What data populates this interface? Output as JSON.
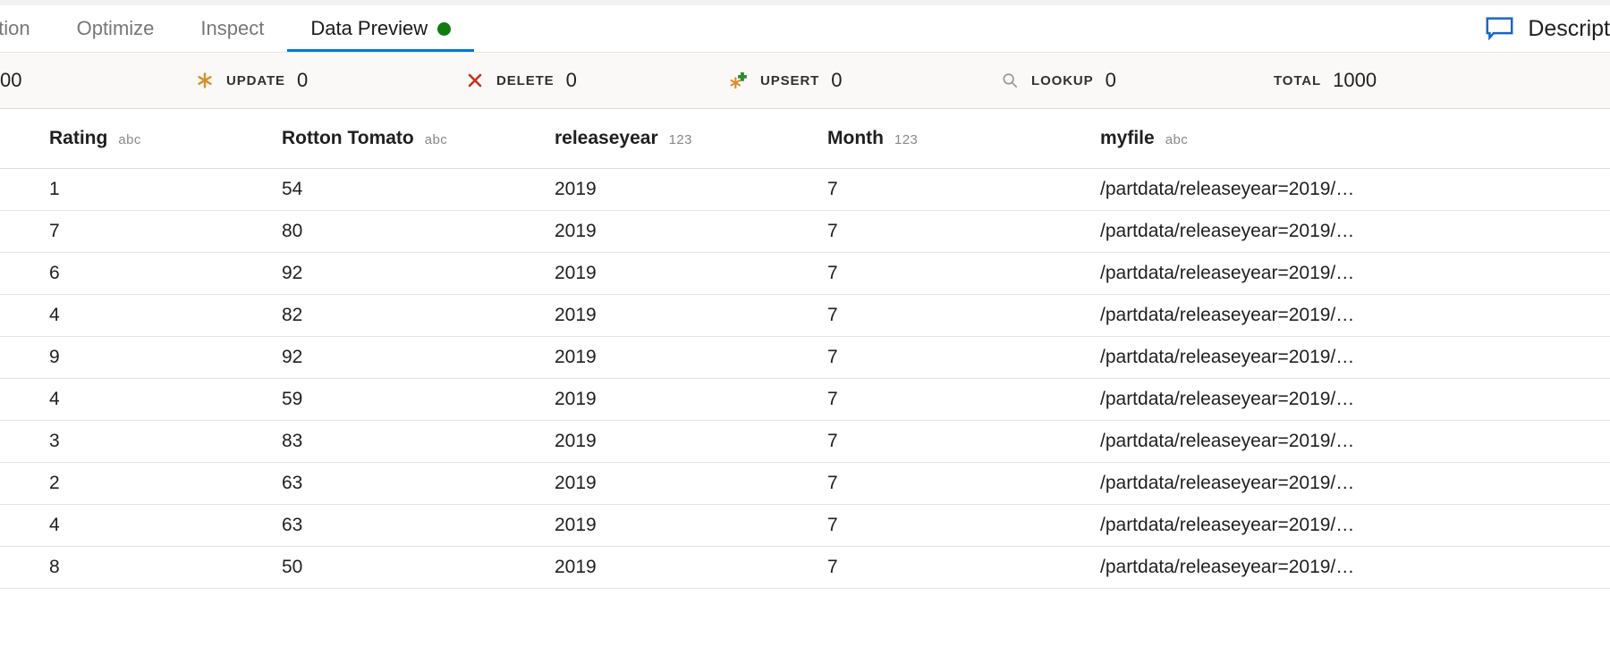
{
  "tabs": [
    {
      "label": "jection",
      "active": false,
      "clipped": true,
      "dot": false
    },
    {
      "label": "Optimize",
      "active": false,
      "clipped": false,
      "dot": false
    },
    {
      "label": "Inspect",
      "active": false,
      "clipped": false,
      "dot": false
    },
    {
      "label": "Data Preview",
      "active": true,
      "clipped": false,
      "dot": true
    }
  ],
  "toolbar": {
    "description_label": "Descript",
    "description_icon": "comment-bubble-icon"
  },
  "stats": {
    "partial_left_value": "00",
    "items": [
      {
        "id": "update",
        "label": "UPDATE",
        "value": "0",
        "icon": "asterisk-icon",
        "color": "#d98f2b"
      },
      {
        "id": "delete",
        "label": "DELETE",
        "value": "0",
        "icon": "cross-icon",
        "color": "#c4321c"
      },
      {
        "id": "upsert",
        "label": "UPSERT",
        "value": "0",
        "icon": "asterisk-plus-icon",
        "color": "#d98f2b"
      },
      {
        "id": "lookup",
        "label": "LOOKUP",
        "value": "0",
        "icon": "search-icon",
        "color": "#8a8886"
      },
      {
        "id": "total",
        "label": "TOTAL",
        "value": "1000",
        "icon": "none",
        "color": "#323130"
      }
    ]
  },
  "table": {
    "columns": [
      {
        "name": "Rating",
        "type": "abc"
      },
      {
        "name": "Rotton Tomato",
        "type": "abc"
      },
      {
        "name": "releaseyear",
        "type": "123"
      },
      {
        "name": "Month",
        "type": "123"
      },
      {
        "name": "myfile",
        "type": "abc"
      }
    ],
    "rows": [
      [
        "1",
        "54",
        "2019",
        "7",
        "/partdata/releaseyear=2019/…"
      ],
      [
        "7",
        "80",
        "2019",
        "7",
        "/partdata/releaseyear=2019/…"
      ],
      [
        "6",
        "92",
        "2019",
        "7",
        "/partdata/releaseyear=2019/…"
      ],
      [
        "4",
        "82",
        "2019",
        "7",
        "/partdata/releaseyear=2019/…"
      ],
      [
        "9",
        "92",
        "2019",
        "7",
        "/partdata/releaseyear=2019/…"
      ],
      [
        "4",
        "59",
        "2019",
        "7",
        "/partdata/releaseyear=2019/…"
      ],
      [
        "3",
        "83",
        "2019",
        "7",
        "/partdata/releaseyear=2019/…"
      ],
      [
        "2",
        "63",
        "2019",
        "7",
        "/partdata/releaseyear=2019/…"
      ],
      [
        "4",
        "63",
        "2019",
        "7",
        "/partdata/releaseyear=2019/…"
      ],
      [
        "8",
        "50",
        "2019",
        "7",
        "/partdata/releaseyear=2019/…"
      ]
    ]
  },
  "colors": {
    "accent": "#0078d4",
    "active_dot": "#107c10",
    "header_bg": "#faf9f8",
    "grid_line": "#e3e3e3"
  }
}
